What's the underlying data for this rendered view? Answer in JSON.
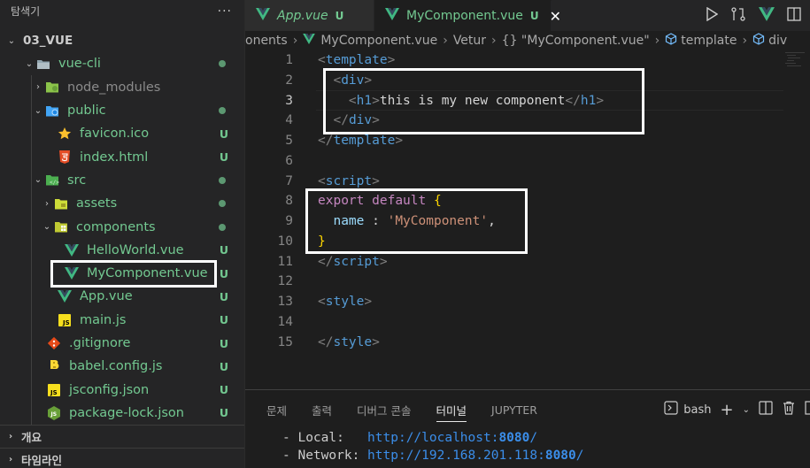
{
  "sidebar": {
    "title": "탐색기",
    "more": "···",
    "root": "03_VUE",
    "items": [
      {
        "label": "vue-cli",
        "status": "dot"
      },
      {
        "label": "node_modules",
        "status": ""
      },
      {
        "label": "public",
        "status": "dot"
      },
      {
        "label": "favicon.ico",
        "status": "U"
      },
      {
        "label": "index.html",
        "status": "U"
      },
      {
        "label": "src",
        "status": "dot"
      },
      {
        "label": "assets",
        "status": "dot"
      },
      {
        "label": "components",
        "status": "dot"
      },
      {
        "label": "HelloWorld.vue",
        "status": "U"
      },
      {
        "label": "MyComponent.vue",
        "status": "U"
      },
      {
        "label": "App.vue",
        "status": "U"
      },
      {
        "label": "main.js",
        "status": "U"
      },
      {
        "label": ".gitignore",
        "status": "U"
      },
      {
        "label": "babel.config.js",
        "status": "U"
      },
      {
        "label": "jsconfig.json",
        "status": "U"
      },
      {
        "label": "package-lock.json",
        "status": "U"
      }
    ],
    "outline": "개요",
    "timeline": "타임라인"
  },
  "tabs": [
    {
      "label": "App.vue",
      "status": "U"
    },
    {
      "label": "MyComponent.vue",
      "status": "U",
      "close": "✕"
    }
  ],
  "breadcrumb": [
    "onents",
    "MyComponent.vue",
    "Vetur",
    "{} \"MyComponent.vue\"",
    "template",
    "div"
  ],
  "editor": {
    "line_numbers": [
      "1",
      "2",
      "3",
      "4",
      "5",
      "6",
      "7",
      "8",
      "9",
      "10",
      "11",
      "12",
      "13",
      "14",
      "15"
    ],
    "h1_text": "this is my new component",
    "export_kw": "export",
    "default_kw": "default",
    "name_key": "name",
    "name_value": "'MyComponent'"
  },
  "panel": {
    "tabs": [
      "문제",
      "출력",
      "디버그 콘솔",
      "터미널",
      "JUPYTER"
    ],
    "active_tab": "터미널",
    "shell": "bash",
    "terminal": {
      "local_label": "- Local:",
      "local_url": "http://localhost:",
      "local_port": "8080",
      "network_label": "- Network:",
      "network_url": "http://192.168.201.118:",
      "network_port": "8080"
    }
  },
  "colors": {
    "accent_green": "#73c991",
    "vue_green": "#41b883",
    "tag_blue": "#569cd6",
    "keyword_purple": "#c586c0",
    "string_orange": "#ce9178"
  }
}
